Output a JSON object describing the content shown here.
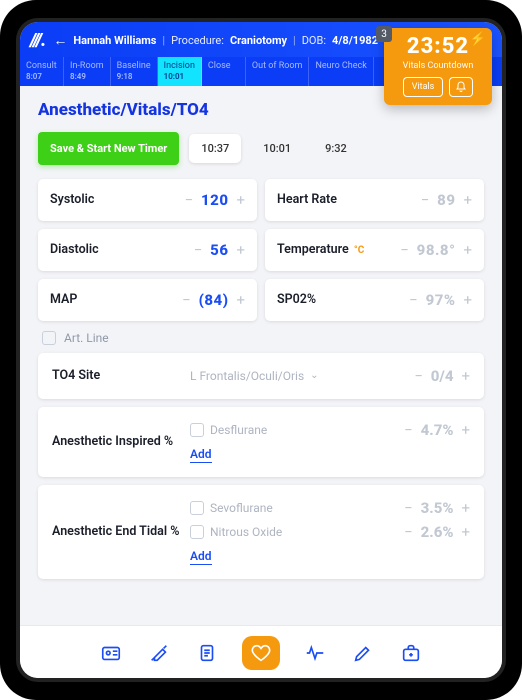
{
  "header": {
    "patient_name": "Hannah Williams",
    "procedure_label": "Procedure:",
    "procedure_value": "Craniotomy",
    "dob_label": "DOB:",
    "dob_value": "4/8/1982"
  },
  "countdown": {
    "badge": "3",
    "time": "23:52",
    "label": "Vitals Countdown",
    "vitals_btn": "Vitals"
  },
  "tabs": [
    {
      "label": "Consult",
      "time": "8:07"
    },
    {
      "label": "In-Room",
      "time": "8:49"
    },
    {
      "label": "Baseline",
      "time": "9:18"
    },
    {
      "label": "Incision",
      "time": "10:01"
    },
    {
      "label": "Close",
      "time": ""
    },
    {
      "label": "Out of Room",
      "time": ""
    },
    {
      "label": "Neuro Check",
      "time": ""
    }
  ],
  "page": {
    "title": "Anesthetic/Vitals/TO4",
    "save_label": "Save & Start New Timer",
    "time_chips": [
      "10:37",
      "10:01",
      "9:32"
    ]
  },
  "vitals": {
    "systolic_label": "Systolic",
    "systolic_value": "120",
    "diastolic_label": "Diastolic",
    "diastolic_value": "56",
    "map_label": "MAP",
    "map_value": "(84)",
    "hr_label": "Heart Rate",
    "hr_value": "89",
    "temp_label": "Temperature",
    "temp_unit": "°C",
    "temp_value": "98.8°",
    "spo2_label": "SP02%",
    "spo2_value": "97%"
  },
  "artline": {
    "label": "Art. Line"
  },
  "to4": {
    "label": "TO4 Site",
    "site": "L Frontalis/Oculi/Oris",
    "value": "0/4"
  },
  "inspired": {
    "label": "Anesthetic Inspired %",
    "agent": "Desflurane",
    "value": "4.7%",
    "add": "Add"
  },
  "endtidal": {
    "label": "Anesthetic End Tidal %",
    "agent1": "Sevoflurane",
    "value1": "3.5%",
    "agent2": "Nitrous Oxide",
    "value2": "2.6%",
    "add": "Add"
  }
}
